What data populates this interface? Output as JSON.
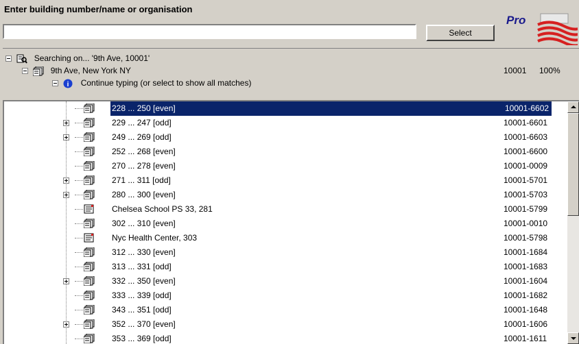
{
  "header": {
    "label": "Enter building number/name or organisation",
    "input_value": "",
    "select_label": "Select",
    "logo_text": "Pro"
  },
  "tree_header": {
    "searching": "Searching on... '9th Ave, 10001'",
    "street": "9th Ave, New York NY",
    "street_zip": "10001",
    "street_pct": "100%",
    "hint": "Continue typing (or select to show all matches)"
  },
  "rows": [
    {
      "label": "228 ... 250  [even]",
      "code": "10001-6602",
      "expand": false,
      "icon": "multi-address-icon",
      "selected": true
    },
    {
      "label": "229 ... 247  [odd]",
      "code": "10001-6601",
      "expand": true,
      "icon": "multi-address-icon"
    },
    {
      "label": "249 ... 269  [odd]",
      "code": "10001-6603",
      "expand": true,
      "icon": "multi-address-icon"
    },
    {
      "label": "252 ... 268  [even]",
      "code": "10001-6600",
      "expand": false,
      "icon": "multi-address-icon"
    },
    {
      "label": "270 ... 278  [even]",
      "code": "10001-0009",
      "expand": false,
      "icon": "multi-address-icon"
    },
    {
      "label": "271 ... 311  [odd]",
      "code": "10001-5701",
      "expand": true,
      "icon": "multi-address-icon"
    },
    {
      "label": "280 ... 300  [even]",
      "code": "10001-5703",
      "expand": true,
      "icon": "multi-address-icon"
    },
    {
      "label": "Chelsea School PS 33, 281",
      "code": "10001-5799",
      "expand": false,
      "icon": "single-address-icon"
    },
    {
      "label": "302 ... 310  [even]",
      "code": "10001-0010",
      "expand": false,
      "icon": "multi-address-icon"
    },
    {
      "label": "Nyc Health Center, 303",
      "code": "10001-5798",
      "expand": false,
      "icon": "single-address-icon"
    },
    {
      "label": "312 ... 330  [even]",
      "code": "10001-1684",
      "expand": false,
      "icon": "multi-address-icon"
    },
    {
      "label": "313 ... 331  [odd]",
      "code": "10001-1683",
      "expand": false,
      "icon": "multi-address-icon"
    },
    {
      "label": "332 ... 350  [even]",
      "code": "10001-1604",
      "expand": true,
      "icon": "multi-address-icon"
    },
    {
      "label": "333 ... 339  [odd]",
      "code": "10001-1682",
      "expand": false,
      "icon": "multi-address-icon"
    },
    {
      "label": "343 ... 351  [odd]",
      "code": "10001-1648",
      "expand": false,
      "icon": "multi-address-icon"
    },
    {
      "label": "352 ... 370  [even]",
      "code": "10001-1606",
      "expand": true,
      "icon": "multi-address-icon"
    },
    {
      "label": "353 ... 369  [odd]",
      "code": "10001-1611",
      "expand": false,
      "icon": "multi-address-icon"
    }
  ],
  "colors": {
    "selection": "#0a246a",
    "chrome": "#d4d0c8"
  }
}
